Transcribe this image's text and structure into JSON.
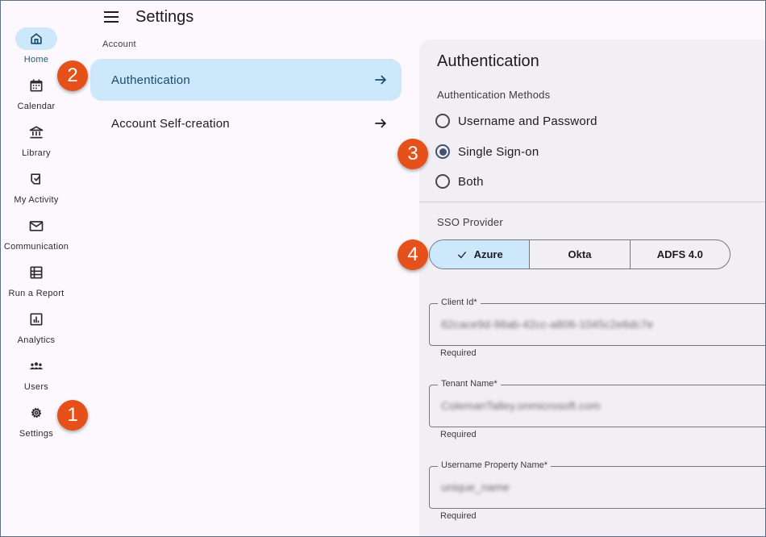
{
  "header": {
    "title": "Settings"
  },
  "rail": {
    "items": [
      {
        "label": "Home",
        "icon": "home-icon",
        "active": true
      },
      {
        "label": "Calendar",
        "icon": "calendar-icon"
      },
      {
        "label": "Library",
        "icon": "library-icon"
      },
      {
        "label": "My Activity",
        "icon": "activity-icon"
      },
      {
        "label": "Communication",
        "icon": "mail-icon"
      },
      {
        "label": "Run a Report",
        "icon": "report-icon"
      },
      {
        "label": "Analytics",
        "icon": "analytics-icon"
      },
      {
        "label": "Users",
        "icon": "users-icon"
      },
      {
        "label": "Settings",
        "icon": "gear-icon"
      }
    ]
  },
  "settings_nav": {
    "section": "Account",
    "items": [
      {
        "label": "Authentication",
        "active": true
      },
      {
        "label": "Account Self-creation"
      }
    ]
  },
  "panel": {
    "title": "Authentication",
    "methods_label": "Authentication Methods",
    "methods": [
      {
        "label": "Username and Password",
        "checked": false
      },
      {
        "label": "Single Sign-on",
        "checked": true
      },
      {
        "label": "Both",
        "checked": false
      }
    ],
    "sso_label": "SSO Provider",
    "providers": [
      {
        "label": "Azure",
        "selected": true
      },
      {
        "label": "Okta"
      },
      {
        "label": "ADFS 4.0"
      }
    ],
    "fields": [
      {
        "label": "Client Id*",
        "value": "62cace9d-98ab-42cc-a806-1045c2e6dc7e",
        "helper": "Required"
      },
      {
        "label": "Tenant Name*",
        "value": "ColemanTalley.onmicrosoft.com",
        "helper": "Required"
      },
      {
        "label": "Username Property Name*",
        "value": "unique_name",
        "helper": "Required"
      }
    ]
  },
  "callouts": [
    "1",
    "2",
    "3",
    "4"
  ],
  "colors": {
    "accent": "#cde8fb",
    "badge": "#e6501a",
    "panel": "#f2eff4"
  }
}
